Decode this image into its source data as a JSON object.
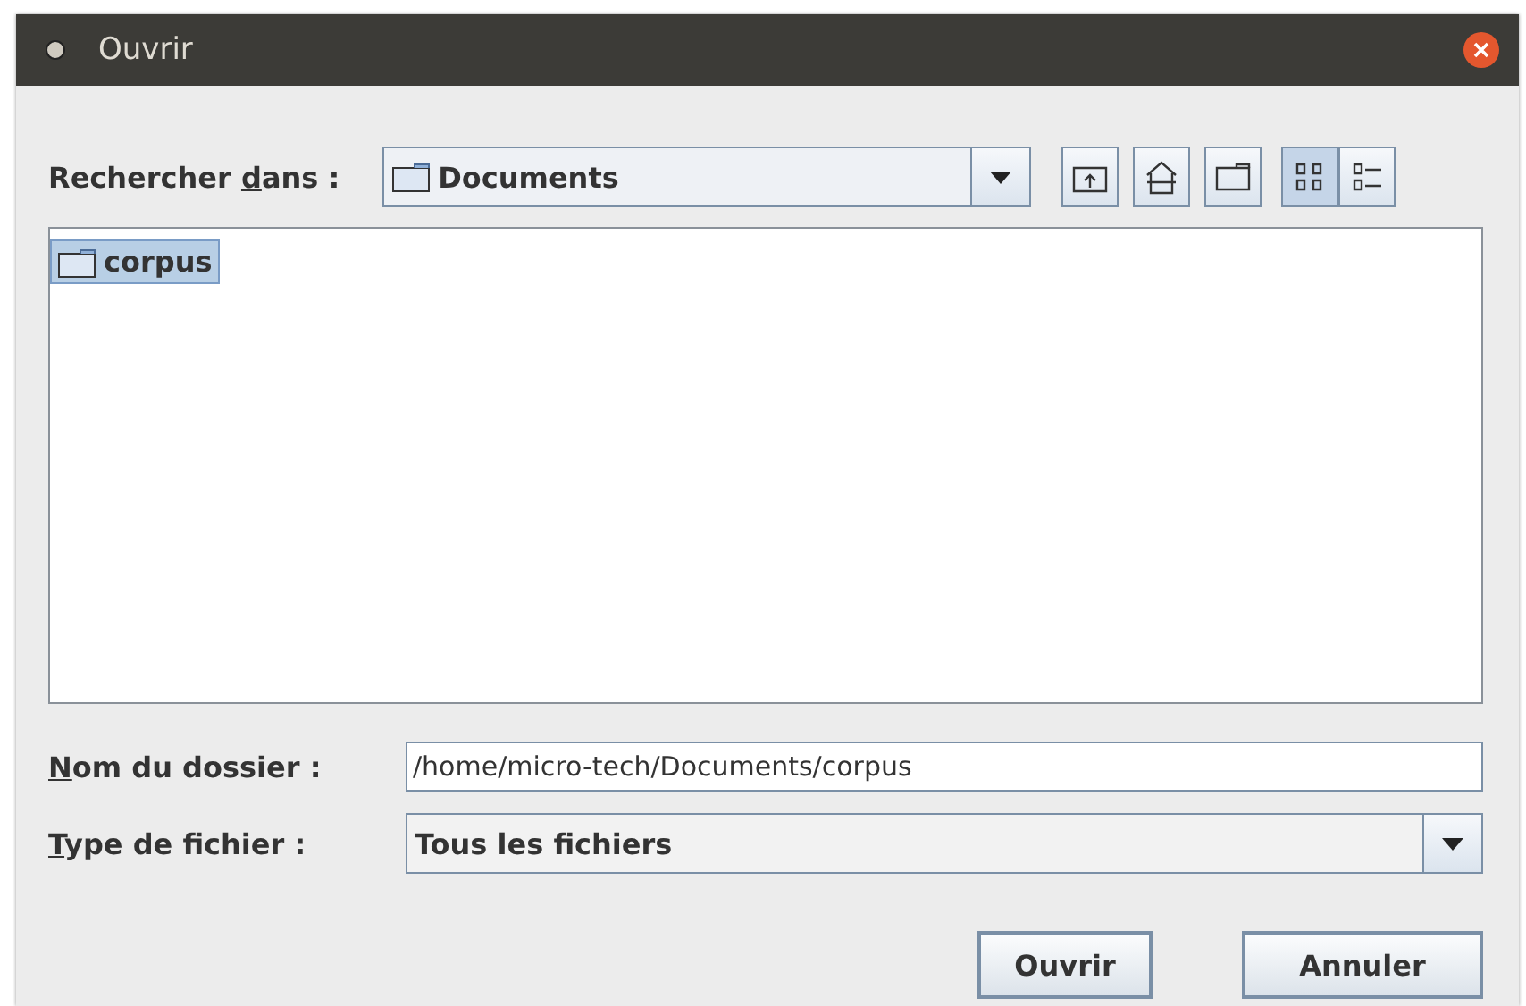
{
  "window": {
    "title": "Ouvrir"
  },
  "look_in": {
    "label": {
      "before": "Rechercher ",
      "key": "d",
      "after": "ans :"
    },
    "value": "Documents"
  },
  "toolbar": [
    {
      "kind": "up",
      "selected": false
    },
    {
      "kind": "home",
      "selected": false
    },
    {
      "kind": "new-folder",
      "selected": false
    },
    {
      "kind": "list",
      "selected": true
    },
    {
      "kind": "details",
      "selected": false
    }
  ],
  "files": [
    {
      "name": "corpus",
      "selected": true
    }
  ],
  "folder_name": {
    "label": {
      "key": "N",
      "after": "om du dossier :"
    },
    "value": "/home/micro-tech/Documents/corpus"
  },
  "file_type": {
    "label": {
      "key": "T",
      "after": "ype de fichier :"
    },
    "value": "Tous les fichiers"
  },
  "buttons": [
    "Ouvrir",
    "Annuler"
  ]
}
